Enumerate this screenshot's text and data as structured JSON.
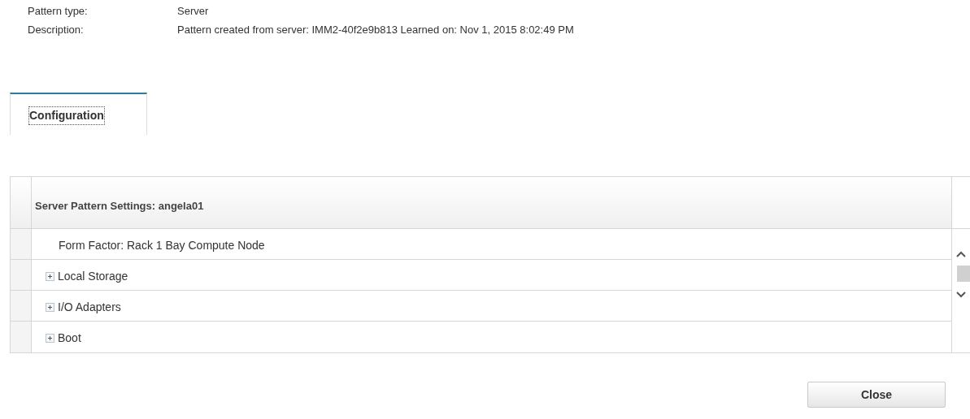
{
  "details": [
    {
      "label": "Pattern type:",
      "value": "Server"
    },
    {
      "label": "Description:",
      "value": "Pattern created from server: IMM2-40f2e9b813 Learned on: Nov 1, 2015 8:02:49 PM"
    }
  ],
  "tabs": [
    {
      "label": "Configuration",
      "selected": true
    }
  ],
  "table": {
    "header": "Server Pattern Settings: angela01",
    "rows": [
      {
        "kind": "leaf",
        "label": "Form Factor: Rack 1 Bay Compute Node"
      },
      {
        "kind": "group",
        "label": "Local Storage",
        "expanded": false
      },
      {
        "kind": "group",
        "label": "I/O Adapters",
        "expanded": false
      },
      {
        "kind": "group",
        "label": "Boot",
        "expanded": false
      }
    ]
  },
  "buttons": [
    {
      "label": "Close"
    }
  ]
}
